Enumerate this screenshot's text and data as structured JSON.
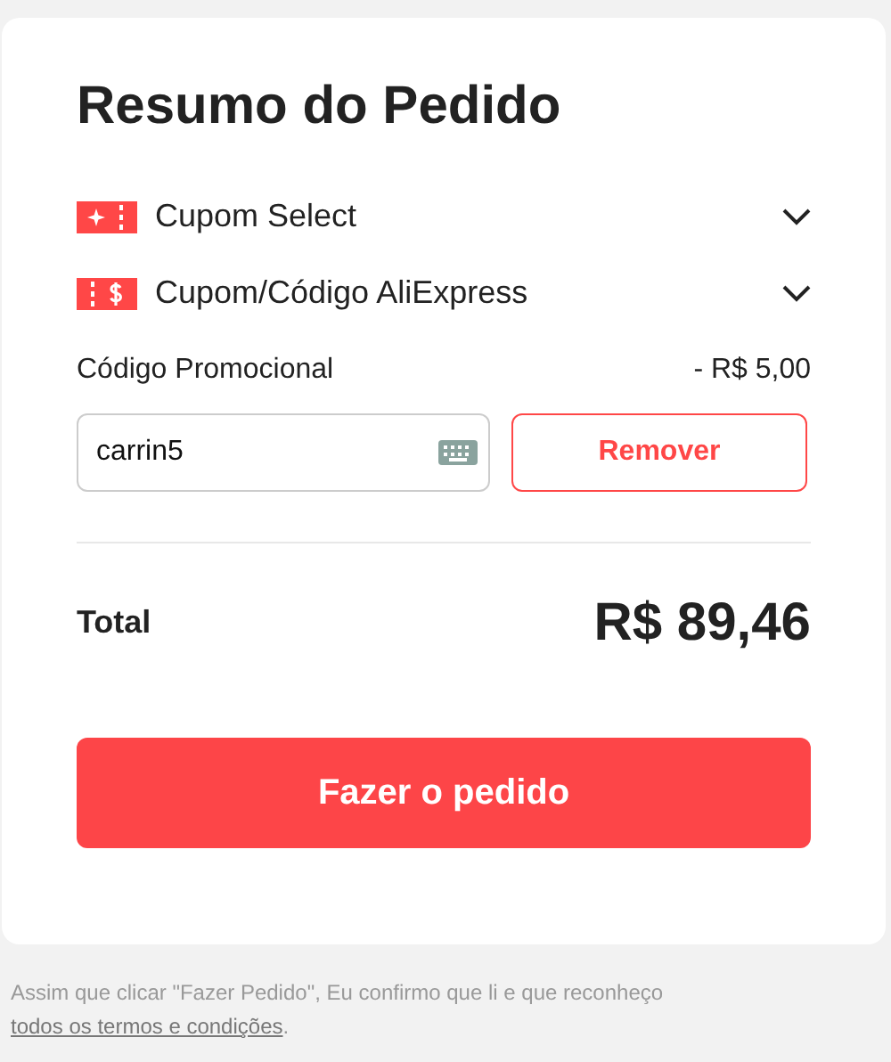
{
  "title": "Resumo do Pedido",
  "coupons": [
    {
      "kind": "select",
      "label": "Cupom Select"
    },
    {
      "kind": "code",
      "label": "Cupom/Código AliExpress"
    }
  ],
  "promo": {
    "label": "Código Promocional",
    "discount": "- R$ 5,00",
    "value": "carrin5",
    "button": "Remover"
  },
  "total": {
    "label": "Total",
    "amount": "R$ 89,46"
  },
  "order_button": "Fazer o pedido",
  "footer": {
    "text": "Assim que clicar \"Fazer Pedido\", Eu confirmo que li e que reconheço ",
    "link": "todos os termos e condições",
    "end": "."
  }
}
